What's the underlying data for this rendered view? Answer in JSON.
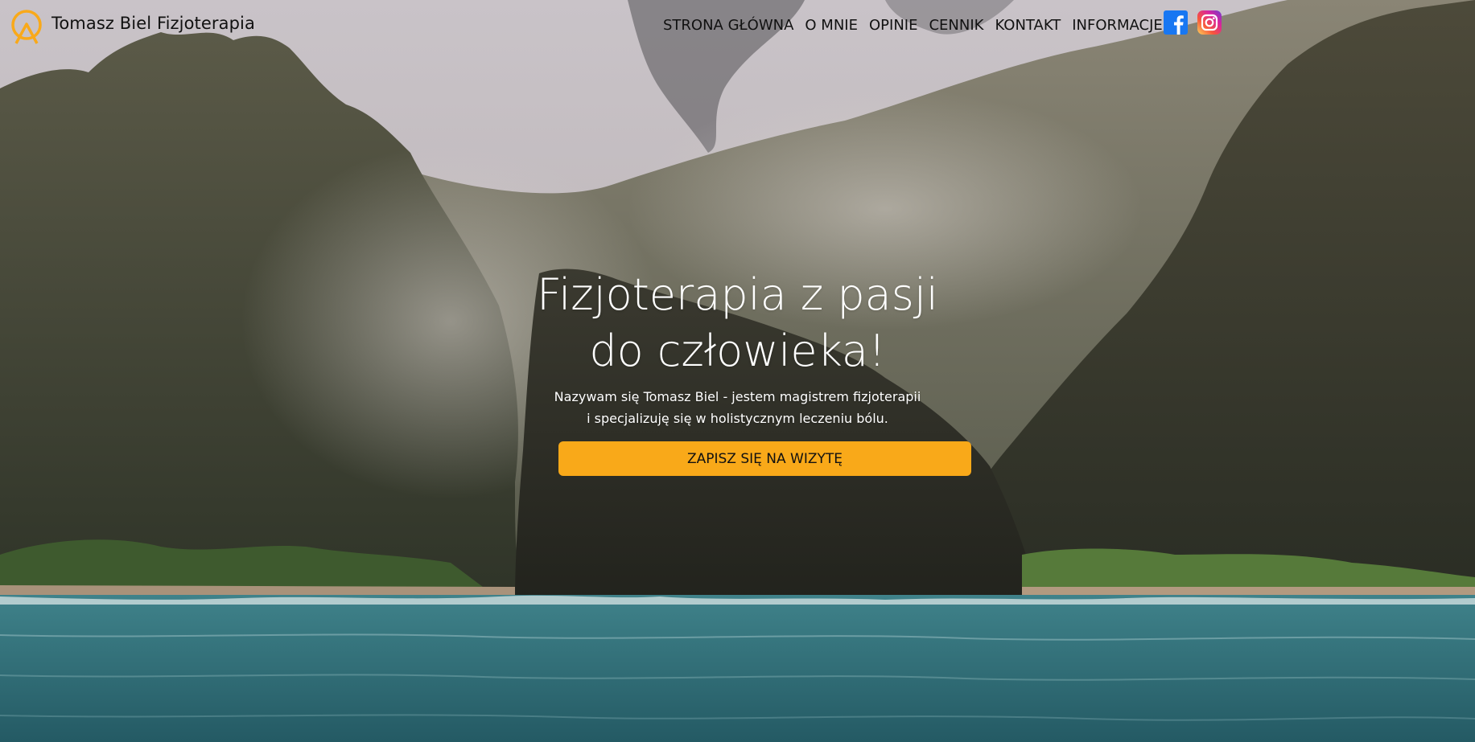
{
  "brand": {
    "name": "Tomasz Biel Fizjoterapia",
    "logo_icon": "person-circle-logo-icon",
    "accent_color": "#f9a919"
  },
  "nav": {
    "items": [
      {
        "label": "STRONA GŁÓWNA"
      },
      {
        "label": "O MNIE"
      },
      {
        "label": "OPINIE"
      },
      {
        "label": "CENNIK"
      },
      {
        "label": "KONTAKT"
      },
      {
        "label": "INFORMACJE"
      }
    ]
  },
  "social": {
    "facebook_icon": "facebook-icon",
    "facebook_color": "#1877f2",
    "instagram_icon": "instagram-icon"
  },
  "hero": {
    "title_line1": "Fizjoterapia z pasji",
    "title_line2": "do człowieka!",
    "subtitle": "Nazywam się Tomasz Biel - jestem magistrem fizjoterapii i specjalizuję się w holistycznym leczeniu bólu.",
    "cta_label": "ZAPISZ SIĘ NA WIZYTĘ"
  }
}
